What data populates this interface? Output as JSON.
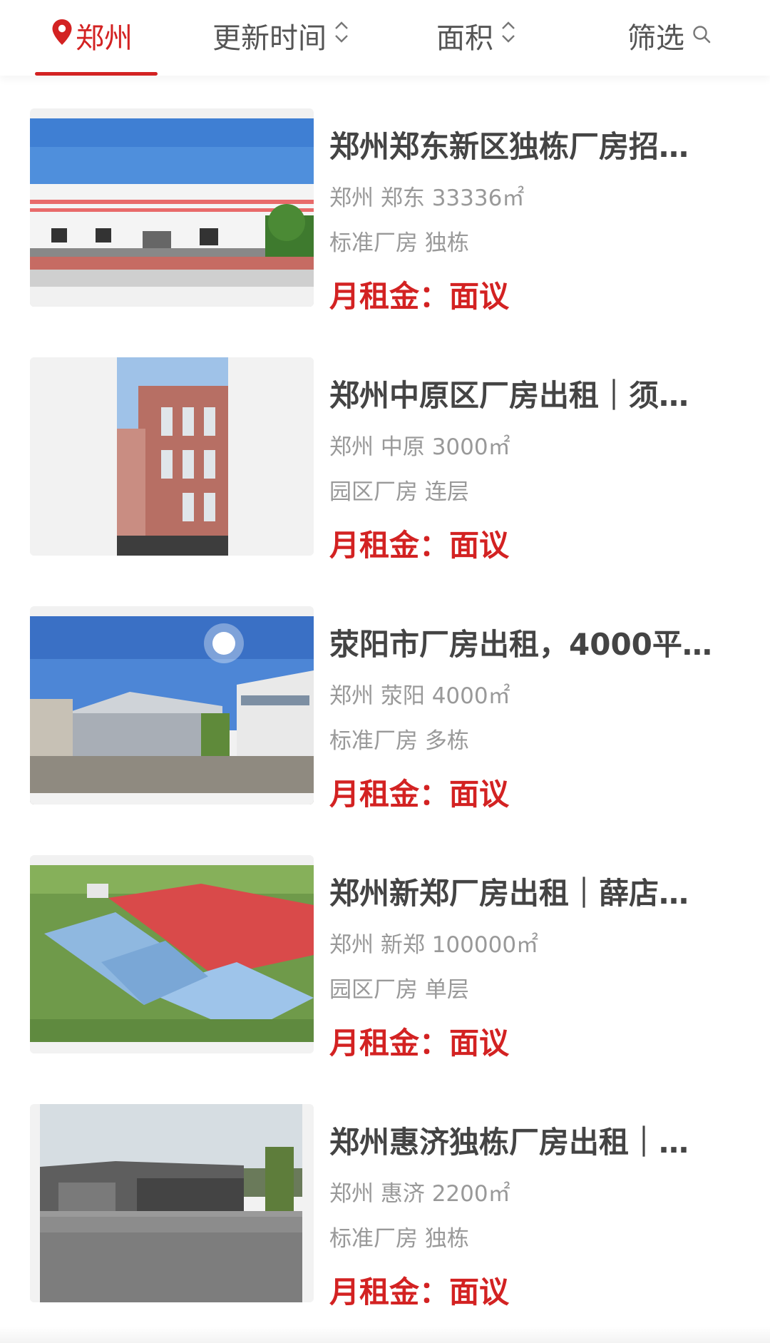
{
  "tabs": {
    "city": "郑州",
    "update_time": "更新时间",
    "area": "面积",
    "filter": "筛选"
  },
  "colors": {
    "accent": "#d32222"
  },
  "listings": [
    {
      "title": "郑州郑东新区独栋厂房招…",
      "location": "郑州 郑东 33336㎡",
      "tags": "标准厂房 独栋",
      "price": "月租金：面议"
    },
    {
      "title": "郑州中原区厂房出租｜须…",
      "location": "郑州 中原 3000㎡",
      "tags": "园区厂房 连层",
      "price": "月租金：面议"
    },
    {
      "title": "荥阳市厂房出租，4000平…",
      "location": "郑州 荥阳 4000㎡",
      "tags": "标准厂房 多栋",
      "price": "月租金：面议"
    },
    {
      "title": "郑州新郑厂房出租｜薛店…",
      "location": "郑州 新郑 100000㎡",
      "tags": "园区厂房 单层",
      "price": "月租金：面议"
    },
    {
      "title": "郑州惠济独栋厂房出租｜…",
      "location": "郑州 惠济 2200㎡",
      "tags": "标准厂房 独栋",
      "price": "月租金：面议"
    }
  ]
}
